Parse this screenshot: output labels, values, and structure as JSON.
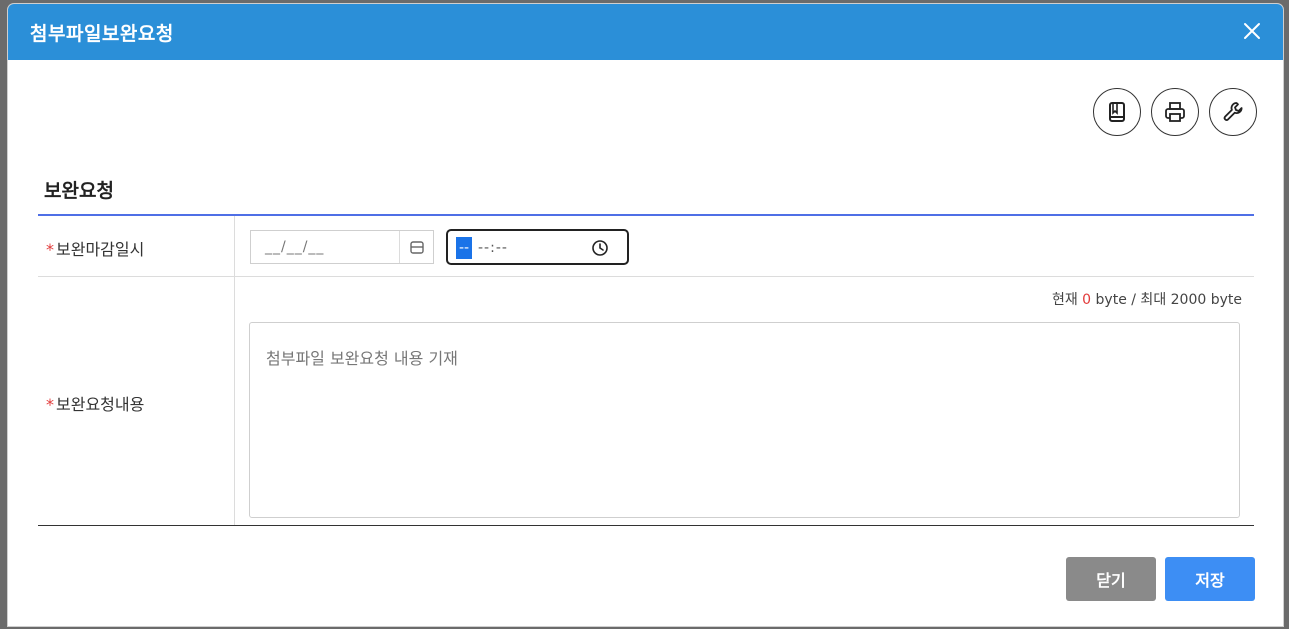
{
  "dialog": {
    "title": "첨부파일보완요청",
    "close_icon": "close-icon"
  },
  "toolbar": {
    "icons": [
      "book-icon",
      "print-icon",
      "wrench-icon"
    ]
  },
  "section": {
    "title": "보완요청"
  },
  "form": {
    "deadline": {
      "required_mark": "*",
      "label": "보완마감일시",
      "date_value": "__/__/__",
      "time_selected": "--",
      "time_rest": "--:--"
    },
    "content": {
      "required_mark": "*",
      "label": "보완요청내용",
      "placeholder": "첨부파일 보완요청 내용 기재",
      "bytes_prefix": "현재 ",
      "bytes_current": "0",
      "bytes_suffix": " byte / 최대 2000 byte"
    }
  },
  "buttons": {
    "close": "닫기",
    "save": "저장"
  },
  "colors": {
    "titlebar": "#2b8fd8",
    "accent_line": "#4f6fe6",
    "required": "#e23a3a",
    "save_button": "#3d8ef4",
    "close_button": "#8a8a8a"
  }
}
